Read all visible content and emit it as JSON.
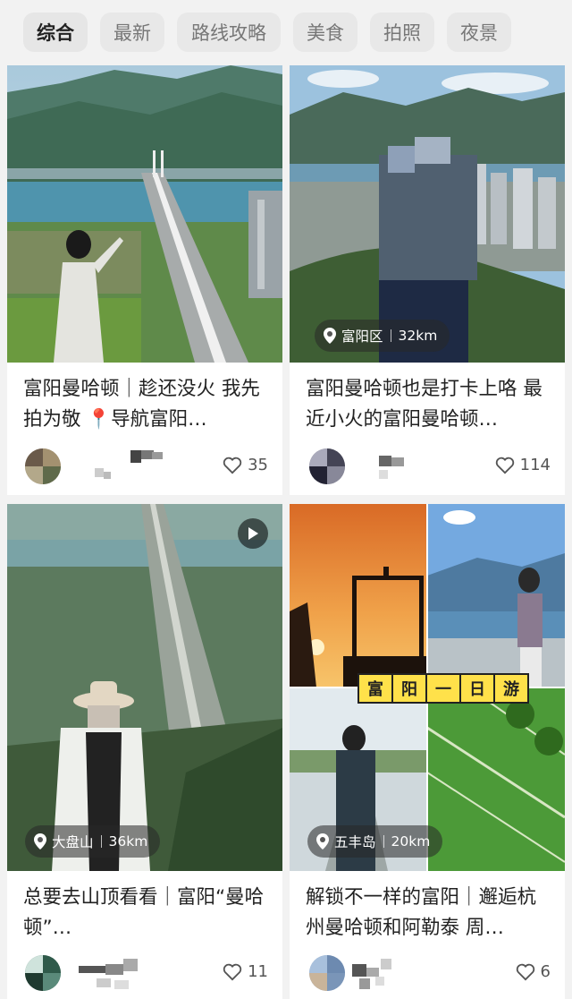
{
  "tabs": [
    "综合",
    "最新",
    "路线攻略",
    "美食",
    "拍照",
    "夜景"
  ],
  "active_tab": 0,
  "cards": [
    {
      "title": "富阳曼哈顿｜趁还没火 我先拍为敬 📍导航富阳…",
      "location": null,
      "distance": null,
      "likes": "35",
      "video": false
    },
    {
      "title": "富阳曼哈顿也是打卡上咯 最近小火的富阳曼哈顿…",
      "location": "富阳区",
      "distance": "32km",
      "likes": "114",
      "video": false
    },
    {
      "title": "总要去山顶看看｜富阳“曼哈顿”…",
      "location": "大盘山",
      "distance": "36km",
      "likes": "11",
      "video": true
    },
    {
      "title": "解锁不一样的富阳｜邂逅杭州曼哈顿和阿勒泰 周…",
      "location": "五丰岛",
      "distance": "20km",
      "likes": "6",
      "video": false
    }
  ],
  "stamp_text": [
    "富",
    "阳",
    "一",
    "日",
    "游"
  ],
  "icons": {
    "heart": "heart-icon",
    "pin": "location-pin-icon",
    "play": "play-icon"
  }
}
